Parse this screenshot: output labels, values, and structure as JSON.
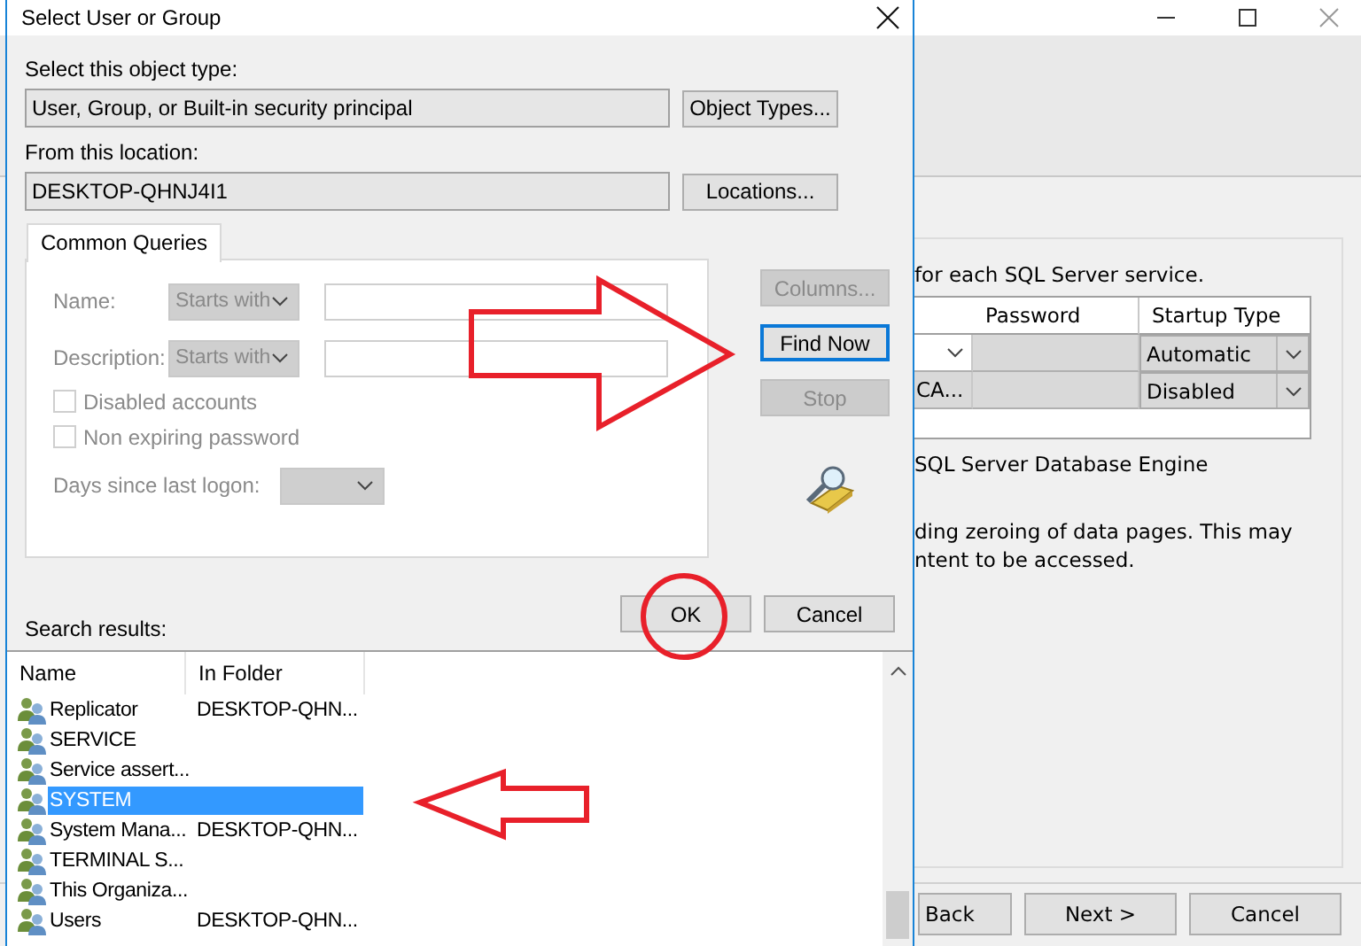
{
  "background_window": {
    "instruction": "for each SQL Server service.",
    "table": {
      "columns": [
        "Password",
        "Startup Type"
      ],
      "rows": [
        {
          "column_1": {
            "kind": "dropdown"
          },
          "startup_type": "Automatic"
        },
        {
          "column_1": {
            "kind": "text",
            "text": "CA..."
          },
          "startup_type": "Disabled"
        }
      ]
    },
    "description_title": "SQL Server Database Engine",
    "description_lines": [
      "ding zeroing of data pages. This may",
      "ntent to be accessed."
    ],
    "buttons": [
      "Back",
      "Next >",
      "Cancel"
    ]
  },
  "dialog": {
    "title": "Select User or Group",
    "object_type": {
      "label": "Select this object type:",
      "value": "User, Group, or Built-in security principal",
      "button": "Object Types..."
    },
    "location": {
      "label": "From this location:",
      "value": "DESKTOP-QHNJ4I1",
      "button": "Locations..."
    },
    "tabs": [
      {
        "label": "Common Queries",
        "selected": true
      }
    ],
    "queries": {
      "name_label": "Name:",
      "name_match": "Starts with",
      "description_label": "Description:",
      "description_match": "Starts with",
      "checkboxes": [
        {
          "label": "Disabled accounts",
          "checked": false
        },
        {
          "label": "Non expiring password",
          "checked": false
        }
      ],
      "days_label": "Days since last logon:",
      "disabled": true
    },
    "side_buttons": [
      {
        "label": "Columns...",
        "disabled": true,
        "focused": false
      },
      {
        "label": "Find Now",
        "disabled": false,
        "focused": true
      },
      {
        "label": "Stop",
        "disabled": true,
        "focused": false
      }
    ],
    "ok_button": "OK",
    "cancel_button": "Cancel",
    "results_label": "Search results:",
    "results": {
      "columns": [
        "Name",
        "In Folder"
      ],
      "rows": [
        {
          "name": "Replicator",
          "folder": "DESKTOP-QHN...",
          "selected": false
        },
        {
          "name": "SERVICE",
          "selected": false
        },
        {
          "name": "Service assert...",
          "selected": false
        },
        {
          "name": "SYSTEM",
          "selected": true
        },
        {
          "name": "System Mana...",
          "folder": "DESKTOP-QHN...",
          "selected": false
        },
        {
          "name": "TERMINAL S...",
          "selected": false
        },
        {
          "name": "This Organiza...",
          "selected": false
        },
        {
          "name": "Users",
          "folder": "DESKTOP-QHN...",
          "selected": false
        }
      ]
    }
  }
}
